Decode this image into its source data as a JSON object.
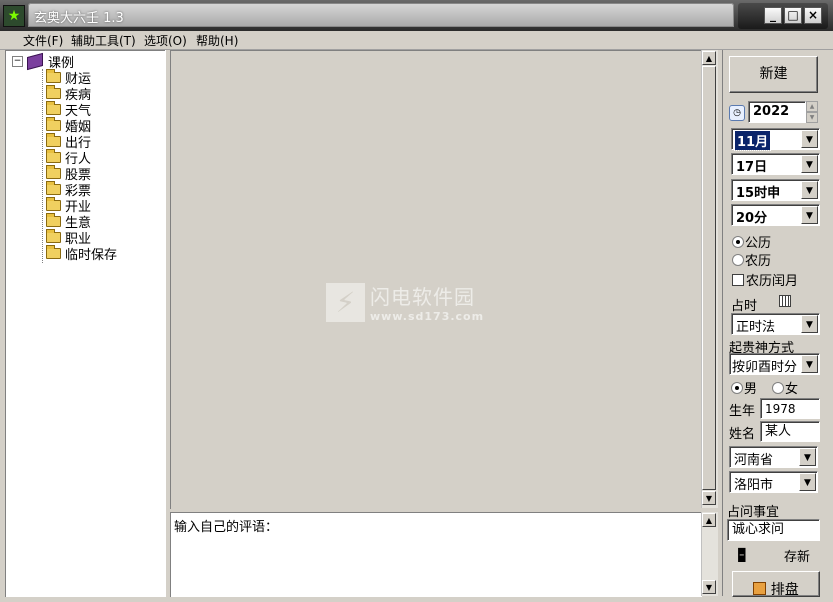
{
  "window": {
    "title": "玄奥大六壬 1.3"
  },
  "menu": [
    {
      "label": "文件(F)"
    },
    {
      "label": "辅助工具(T)"
    },
    {
      "label": "选项(O)"
    },
    {
      "label": "帮助(H)"
    }
  ],
  "tree": {
    "root": "课例",
    "items": [
      "财运",
      "疾病",
      "天气",
      "婚姻",
      "出行",
      "行人",
      "股票",
      "彩票",
      "开业",
      "生意",
      "职业",
      "临时保存"
    ]
  },
  "comment": {
    "text": "输入自己的评语："
  },
  "watermark": {
    "title": "闪电软件园",
    "url": "www.sd173.com"
  },
  "panel": {
    "new_button": "新建",
    "year": "2022",
    "month": "11月",
    "day": "17日",
    "hour": "15时申",
    "minute": "20分",
    "calendar_solar": "公历",
    "calendar_lunar": "农历",
    "leap_month": "农历闰月",
    "divination_time_label": "占时",
    "divination_method": "正时法",
    "noble_method_label": "起贵神方式",
    "noble_method": "按卯酉时分",
    "gender_male": "男",
    "gender_female": "女",
    "birth_year_label": "生年",
    "birth_year": "1978",
    "name_label": "姓名",
    "name": "某人",
    "province": "河南省",
    "city": "洛阳市",
    "matter_label": "占问事宜",
    "matter": "诚心求问",
    "save_button": "存新",
    "arrange_button": "排盘"
  }
}
